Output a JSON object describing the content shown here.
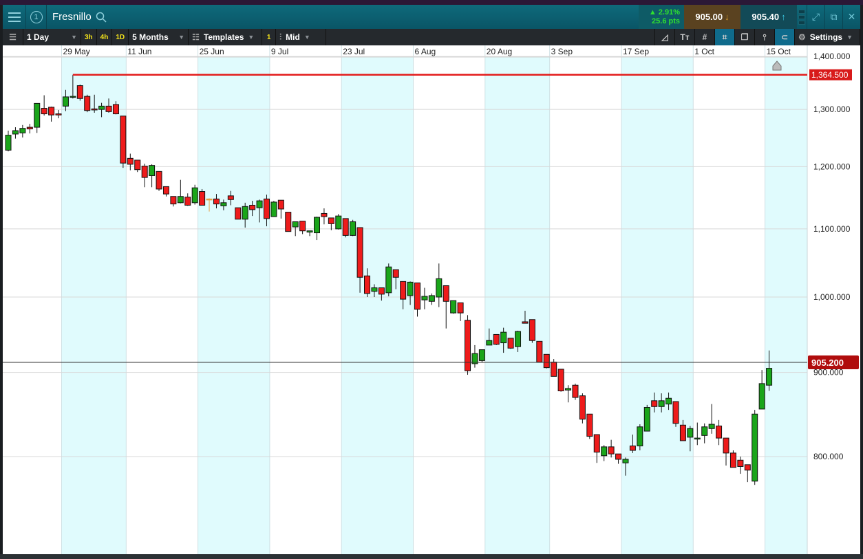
{
  "header": {
    "instrument_number": "1",
    "title": "Fresnillo",
    "change_pct": "▲ 2.91%",
    "change_pts": "25.6 pts",
    "sell_price": "905.00",
    "buy_price": "905.40"
  },
  "toolbar": {
    "interval": "1 Day",
    "quick_intervals": [
      "3h",
      "4h",
      "1D"
    ],
    "range": "5 Months",
    "templates": "Templates",
    "layout_count": "1",
    "price_type": "Mid",
    "settings": "Settings"
  },
  "colors": {
    "up": "#1aa51a",
    "down": "#ee1b1b",
    "hline": "#e31b1b",
    "shade": "#e0fbfd"
  },
  "chart_data": {
    "type": "candlestick",
    "scale": "log",
    "yticks": [
      {
        "v": 1400,
        "label": "1,400.000"
      },
      {
        "v": 1300,
        "label": "1,300.000"
      },
      {
        "v": 1200,
        "label": "1,200.000"
      },
      {
        "v": 1100,
        "label": "1,100.000"
      },
      {
        "v": 1000,
        "label": "1,000.000"
      },
      {
        "v": 900,
        "label": "900.000"
      },
      {
        "v": 800,
        "label": "800.000"
      }
    ],
    "xticks": [
      {
        "i": 8,
        "label": "29 May"
      },
      {
        "i": 17,
        "label": "11 Jun"
      },
      {
        "i": 27,
        "label": "25 Jun"
      },
      {
        "i": 37,
        "label": "9 Jul"
      },
      {
        "i": 47,
        "label": "23 Jul"
      },
      {
        "i": 57,
        "label": "6 Aug"
      },
      {
        "i": 67,
        "label": "20 Aug"
      },
      {
        "i": 76,
        "label": "3 Sep"
      },
      {
        "i": 86,
        "label": "17 Sep"
      },
      {
        "i": 96,
        "label": "1 Oct"
      },
      {
        "i": 106,
        "label": "15 Oct"
      }
    ],
    "horizontal_line": {
      "value": 1364.5,
      "label": "1,364.500",
      "start_index": 9
    },
    "last_price": {
      "value": 905.2,
      "label": "905.200"
    },
    "ohlc": [
      [
        1228,
        1262,
        1226,
        1254
      ],
      [
        1256,
        1268,
        1248,
        1262
      ],
      [
        1258,
        1272,
        1250,
        1266
      ],
      [
        1268,
        1274,
        1257,
        1265
      ],
      [
        1268,
        1311,
        1258,
        1311
      ],
      [
        1302,
        1326,
        1289,
        1292
      ],
      [
        1304,
        1305,
        1278,
        1290
      ],
      [
        1292,
        1299,
        1284,
        1290
      ],
      [
        1306,
        1336,
        1297,
        1323
      ],
      [
        1323,
        1364.5,
        1320,
        1324
      ],
      [
        1344,
        1346,
        1316,
        1320
      ],
      [
        1324,
        1327,
        1295,
        1298
      ],
      [
        1301,
        1327,
        1294,
        1299
      ],
      [
        1300,
        1312,
        1286,
        1306
      ],
      [
        1306,
        1320,
        1294,
        1296
      ],
      [
        1309,
        1315,
        1291,
        1292
      ],
      [
        1288,
        1288,
        1198,
        1206
      ],
      [
        1214,
        1222,
        1194,
        1204
      ],
      [
        1211,
        1211,
        1191,
        1195
      ],
      [
        1201,
        1205,
        1166,
        1182
      ],
      [
        1185,
        1204,
        1166,
        1202
      ],
      [
        1192,
        1192,
        1160,
        1163
      ],
      [
        1167,
        1167,
        1151,
        1155
      ],
      [
        1151,
        1151,
        1135,
        1139
      ],
      [
        1141,
        1178,
        1140,
        1151
      ],
      [
        1150,
        1156,
        1136,
        1137
      ],
      [
        1141,
        1170,
        1138,
        1165
      ],
      [
        1159,
        1163,
        1138,
        1137
      ],
      [
        1147,
        1148,
        1127,
        1147
      ],
      [
        1147,
        1155,
        1132,
        1139
      ],
      [
        1136,
        1146,
        1129,
        1141
      ],
      [
        1152,
        1160,
        1137,
        1146
      ],
      [
        1133,
        1133,
        1115,
        1115
      ],
      [
        1115,
        1141,
        1102,
        1135
      ],
      [
        1137,
        1144,
        1120,
        1130
      ],
      [
        1133,
        1146,
        1110,
        1144
      ],
      [
        1147,
        1154,
        1104,
        1116
      ],
      [
        1119,
        1144,
        1119,
        1142
      ],
      [
        1145,
        1145,
        1116,
        1131
      ],
      [
        1126,
        1126,
        1096,
        1096
      ],
      [
        1103,
        1111,
        1089,
        1111
      ],
      [
        1112,
        1112,
        1092,
        1097
      ],
      [
        1095,
        1097,
        1089,
        1097
      ],
      [
        1094,
        1119,
        1083,
        1118
      ],
      [
        1124,
        1132,
        1107,
        1119
      ],
      [
        1117,
        1117,
        1098,
        1108
      ],
      [
        1100,
        1123,
        1099,
        1120
      ],
      [
        1116,
        1116,
        1087,
        1090
      ],
      [
        1090,
        1114,
        1089,
        1111
      ],
      [
        1102,
        1102,
        1006,
        1028
      ],
      [
        1030,
        1041,
        1000,
        1005
      ],
      [
        1008,
        1018,
        1000,
        1013
      ],
      [
        1013,
        1013,
        995,
        1004
      ],
      [
        1006,
        1048,
        1001,
        1043
      ],
      [
        1039,
        1039,
        1011,
        1028
      ],
      [
        1022,
        1022,
        983,
        997
      ],
      [
        1002,
        1022,
        989,
        1021
      ],
      [
        1020,
        1020,
        973,
        983
      ],
      [
        996,
        1013,
        983,
        1001
      ],
      [
        994,
        1005,
        989,
        1002
      ],
      [
        1000,
        1048,
        986,
        1026
      ],
      [
        1016,
        1016,
        957,
        994
      ],
      [
        978,
        995,
        977,
        995
      ],
      [
        992,
        992,
        967,
        978
      ],
      [
        968,
        975,
        897,
        902
      ],
      [
        911,
        935,
        906,
        924
      ],
      [
        915,
        929,
        913,
        929
      ],
      [
        935,
        957,
        935,
        941
      ],
      [
        949,
        949,
        935,
        936
      ],
      [
        938,
        958,
        925,
        952
      ],
      [
        944,
        944,
        930,
        931
      ],
      [
        933,
        954,
        926,
        953
      ],
      [
        966,
        981,
        964,
        964
      ],
      [
        969,
        969,
        938,
        941
      ],
      [
        940,
        940,
        913,
        913
      ],
      [
        923,
        923,
        905,
        906
      ],
      [
        913,
        917,
        895,
        895
      ],
      [
        904,
        904,
        876,
        877
      ],
      [
        878,
        884,
        863,
        880
      ],
      [
        884,
        886,
        866,
        869
      ],
      [
        871,
        874,
        838,
        843
      ],
      [
        849,
        849,
        820,
        823
      ],
      [
        825,
        825,
        793,
        805
      ],
      [
        801,
        813,
        795,
        811
      ],
      [
        811,
        819,
        799,
        803
      ],
      [
        803,
        803,
        792,
        797
      ],
      [
        793,
        799,
        779,
        797
      ],
      [
        812,
        825,
        804,
        807
      ],
      [
        812,
        837,
        807,
        834
      ],
      [
        829,
        860,
        829,
        857
      ],
      [
        865,
        875,
        851,
        858
      ],
      [
        858,
        874,
        851,
        865
      ],
      [
        861,
        875,
        854,
        868
      ],
      [
        864,
        864,
        834,
        838
      ],
      [
        836,
        842,
        818,
        818
      ],
      [
        822,
        835,
        806,
        832
      ],
      [
        821,
        839,
        813,
        821
      ],
      [
        824,
        838,
        815,
        834
      ],
      [
        832,
        861,
        826,
        837
      ],
      [
        835,
        842,
        813,
        821
      ],
      [
        821,
        821,
        790,
        804
      ],
      [
        804,
        807,
        788,
        788
      ],
      [
        796,
        800,
        781,
        789
      ],
      [
        791,
        791,
        772,
        785
      ],
      [
        773,
        854,
        769,
        849
      ],
      [
        855,
        903,
        855,
        886
      ],
      [
        884,
        928,
        877,
        905.2
      ]
    ]
  }
}
